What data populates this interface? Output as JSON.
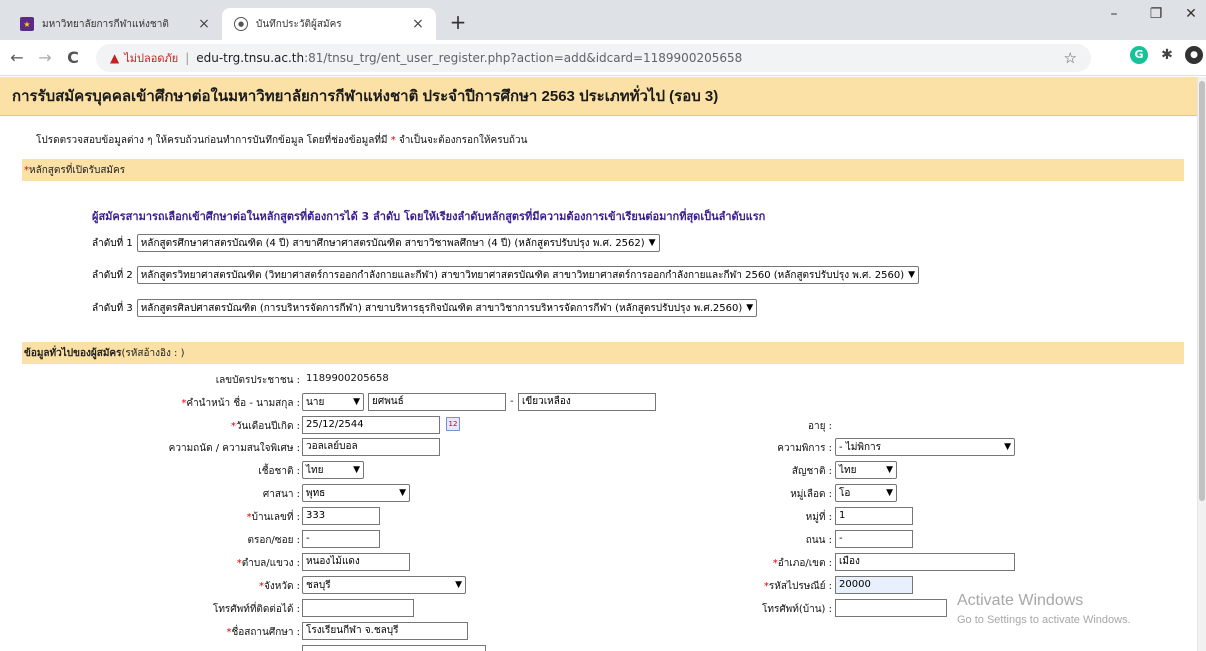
{
  "browser": {
    "tabs": [
      {
        "title": "มหาวิทยาลัยการกีฬาแห่งชาติ",
        "active": false
      },
      {
        "title": "บันทึกประวัติผู้สมัคร",
        "active": true
      }
    ],
    "new_tab": "+",
    "window_controls": {
      "minimize": "–",
      "maximize": "❐",
      "close": "✕"
    },
    "nav": {
      "back": "←",
      "forward": "→",
      "reload": "C"
    },
    "security_label": "ไม่ปลอดภัย",
    "url_host": "edu-trg.tnsu.ac.th",
    "url_path": ":81/tnsu_trg/ent_user_register.php?action=add&idcard=1189900205658"
  },
  "page": {
    "banner": "การรับสมัครบุคคลเข้าศึกษาต่อในมหาวิทยาลัยการกีฬาแห่งชาติ ประจำปีการศึกษา 2563   ประเภททั่วไป (รอบ 3)",
    "note_before": "โปรดตรวจสอบข้อมูลต่าง ๆ ให้ครบถ้วนก่อนทำการบันทึกข้อมูล โดยที่ช่องข้อมูลที่มี ",
    "note_star": "*",
    "note_after": " จำเป็นจะต้องกรอกให้ครบถ้วน",
    "course_section": {
      "star": "*",
      "title": "หลักสูตรที่เปิดรับสมัคร"
    },
    "course_info": "ผู้สมัครสามารถเลือกเข้าศึกษาต่อในหลักสูตรที่ต้องการได้ 3 ลำดับ โดยให้เรียงลำดับหลักสูตรที่มีความต้องการเข้าเรียนต่อมากที่สุดเป็นลำดับแรก",
    "ranks": [
      {
        "label": "ลำดับที่ 1",
        "value": "หลักสูตรศึกษาศาสตรบัณฑิต (4 ปี) สาขาศึกษาศาสตรบัณฑิต สาขาวิชาพลศึกษา (4 ปี) (หลักสูตรปรับปรุง พ.ศ. 2562)"
      },
      {
        "label": "ลำดับที่ 2",
        "value": "หลักสูตรวิทยาศาสตรบัณฑิต (วิทยาศาสตร์การออกกำลังกายและกีฬา) สาขาวิทยาศาสตรบัณฑิต สาขาวิทยาศาสตร์การออกกำลังกายและกีฬา 2560 (หลักสูตรปรับปรุง พ.ศ. 2560)"
      },
      {
        "label": "ลำดับที่ 3",
        "value": "หลักสูตรศิลปศาสตรบัณฑิต (การบริหารจัดการกีฬา) สาขาบริหารธุรกิจบัณฑิต สาขาวิชาการบริหารจัดการกีฬา (หลักสูตรปรับปรุง พ.ศ.2560)"
      }
    ],
    "general_section": {
      "title": "ข้อมูลทั่วไปของผู้สมัคร",
      "ref": " (รหัสอ้างอิง : )"
    },
    "form": {
      "idcard_label": "เลขบัตรประชาชน :",
      "idcard_value": "1189900205658",
      "name_label": "คำนำหน้า ชื่อ - นามสกุล :",
      "prefix": "นาย",
      "firstname": "ยศพนธ์",
      "dash": "-",
      "lastname": "เขียวเหลือง",
      "birth_label": "วันเดือนปีเกิด :",
      "birth_value": "25/12/2544",
      "calendar_icon_text": "12",
      "age_label": "อายุ :",
      "talent_label": "ความถนัด / ความสนใจพิเศษ :",
      "talent_value": "วอลเลย์บอล",
      "disability_label": "ความพิการ :",
      "disability_value": "- ไม่พิการ",
      "race_label": "เชื้อชาติ :",
      "race_value": "ไทย",
      "nationality_label": "สัญชาติ :",
      "nationality_value": "ไทย",
      "religion_label": "ศาสนา :",
      "religion_value": "พุทธ",
      "blood_label": "หมู่เลือด :",
      "blood_value": "โอ",
      "house_label": "บ้านเลขที่ :",
      "house_value": "333",
      "moo_label": "หมู่ที่ :",
      "moo_value": "1",
      "soi_label": "ตรอก/ซอย :",
      "soi_value": "-",
      "road_label": "ถนน :",
      "road_value": "-",
      "subdistrict_label": "ตำบล/แขวง :",
      "subdistrict_value": "หนองไม้แดง",
      "district_label": "อำเภอ/เขต :",
      "district_value": "เมือง",
      "province_label": "จังหวัด :",
      "province_value": "ชลบุรี",
      "postcode_label": "รหัสไปรษณีย์ :",
      "postcode_value": "20000",
      "phone_label": "โทรศัพท์ที่ติดต่อได้ :",
      "phone_value": "",
      "homephone_label": "โทรศัพท์(บ้าน) :",
      "homephone_value": "",
      "school_label": "ชื่อสถานศึกษา :",
      "school_value": "โรงเรียนกีฬา จ.ชลบุรี"
    },
    "watermark": {
      "line1": "Activate Windows",
      "line2": "Go to Settings to activate Windows."
    }
  }
}
